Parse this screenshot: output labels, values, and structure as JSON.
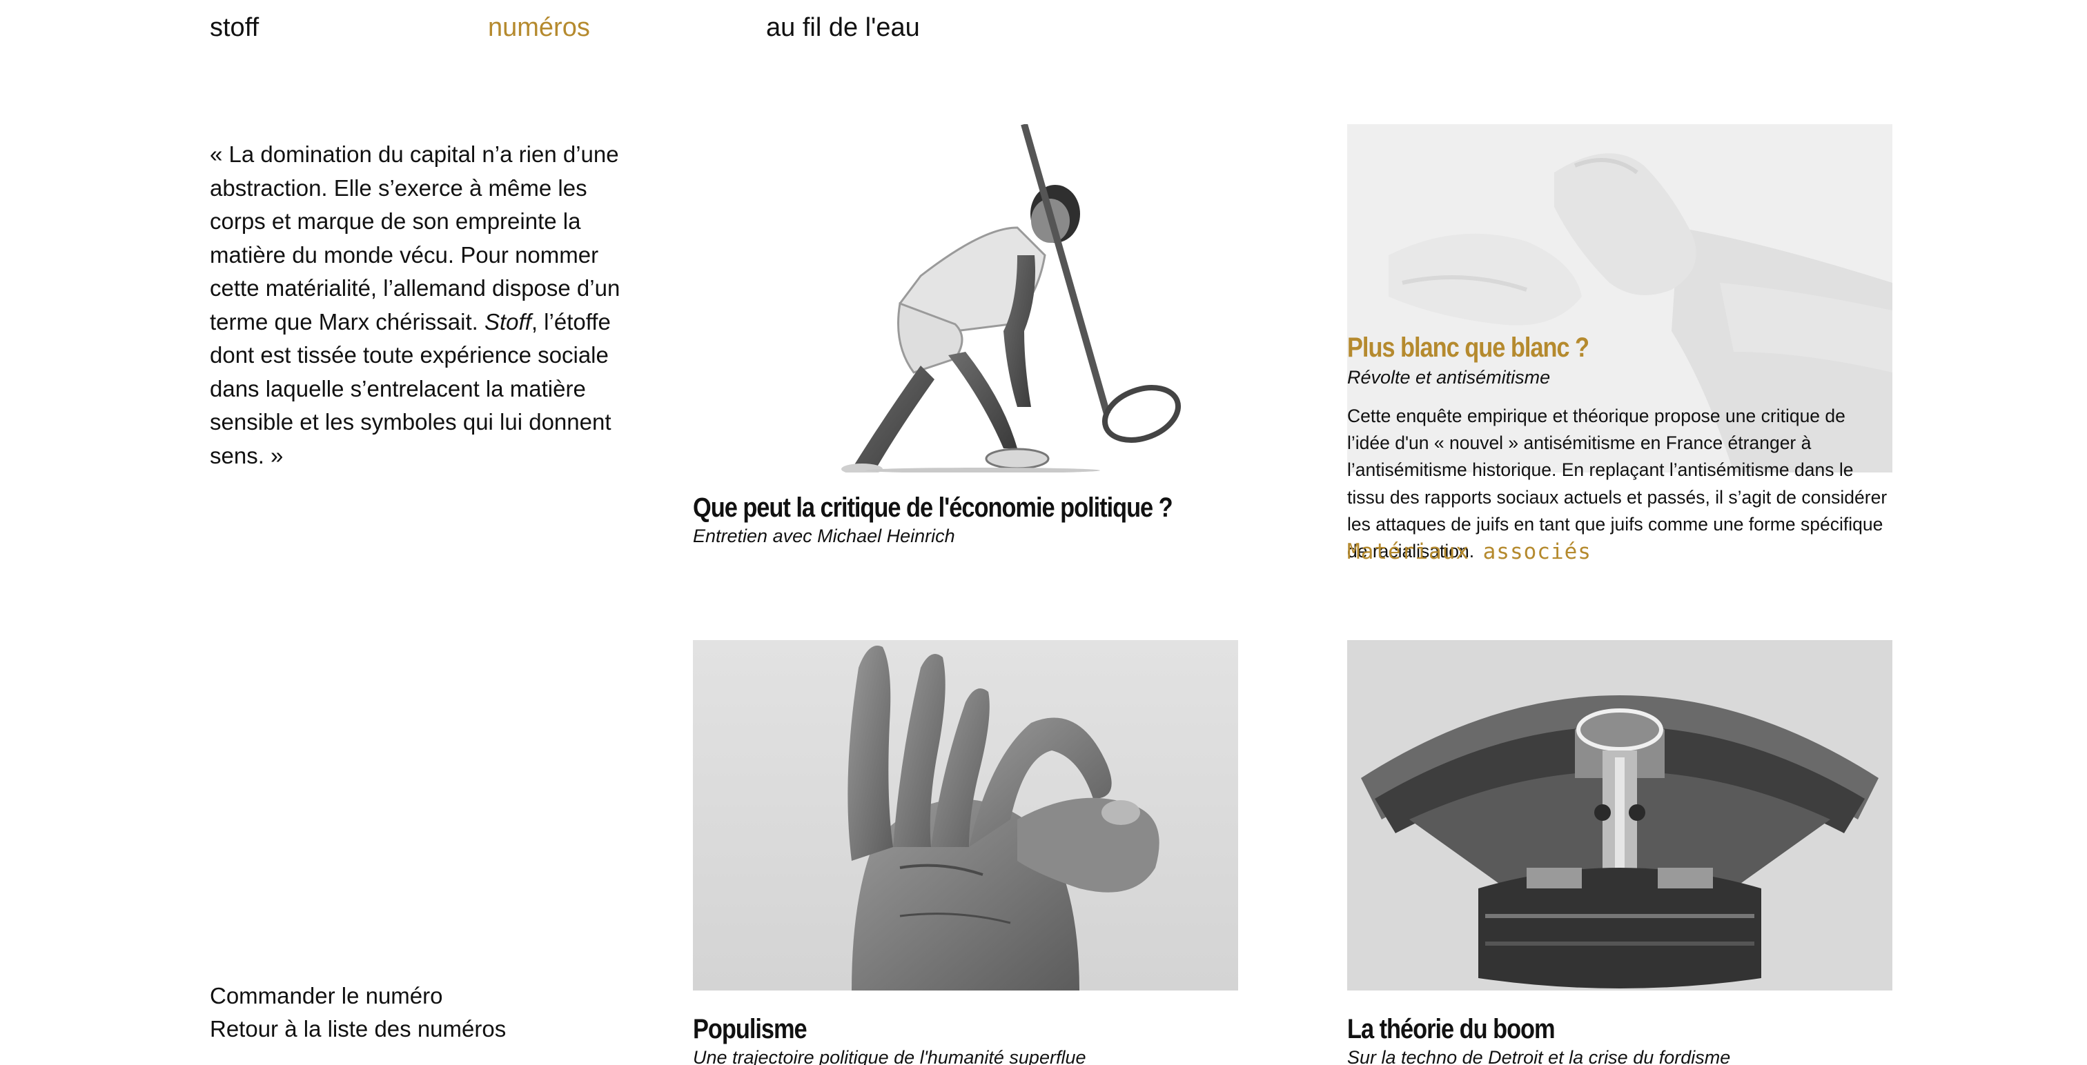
{
  "nav": {
    "items": [
      {
        "label": "stoff"
      },
      {
        "label": "numéros"
      },
      {
        "label": "au fil de l'eau"
      }
    ]
  },
  "intro": {
    "part1": "« La domination du capital n’a rien d’une abstraction. Elle s’exerce à même les corps et marque de son empreinte la matière du monde vécu. Pour nommer cette matérialité, l’allemand dispose d’un terme que Marx chérissait. ",
    "emph": "Stoff",
    "part2": ", l’étoffe dont est tissée toute expérience sociale dans laquelle s’entrelacent la matière sensible et les symboles qui lui donnent sens. »"
  },
  "side_links": {
    "order": "Commander le numéro",
    "back": "Retour à la liste des numéros"
  },
  "articles": [
    {
      "title": "Que peut la critique de l'économie politique ?",
      "subtitle": "Entretien avec Michael Heinrich"
    },
    {
      "title": "Plus blanc que blanc ?",
      "subtitle": "Révolte et antisémitisme",
      "description": "Cette enquête empirique et théorique propose une critique de l’idée d'un « nouvel » antisémitisme en France étranger à l’antisémitisme historique. En replaçant l’antisémitisme dans le tissu des rapports sociaux actuels et passés, il s’agit de considérer les attaques de juifs en tant que juifs comme une forme spécifique de racialisation.",
      "more": "Matériaux associés"
    },
    {
      "title": "Populisme",
      "subtitle": "Une trajectoire politique de l'humanité superflue"
    },
    {
      "title": "La théorie du boom",
      "subtitle": "Sur la techno de Detroit et la crise du fordisme"
    }
  ],
  "colors": {
    "accent": "#b58a2e",
    "text": "#111111",
    "background": "#ffffff"
  }
}
